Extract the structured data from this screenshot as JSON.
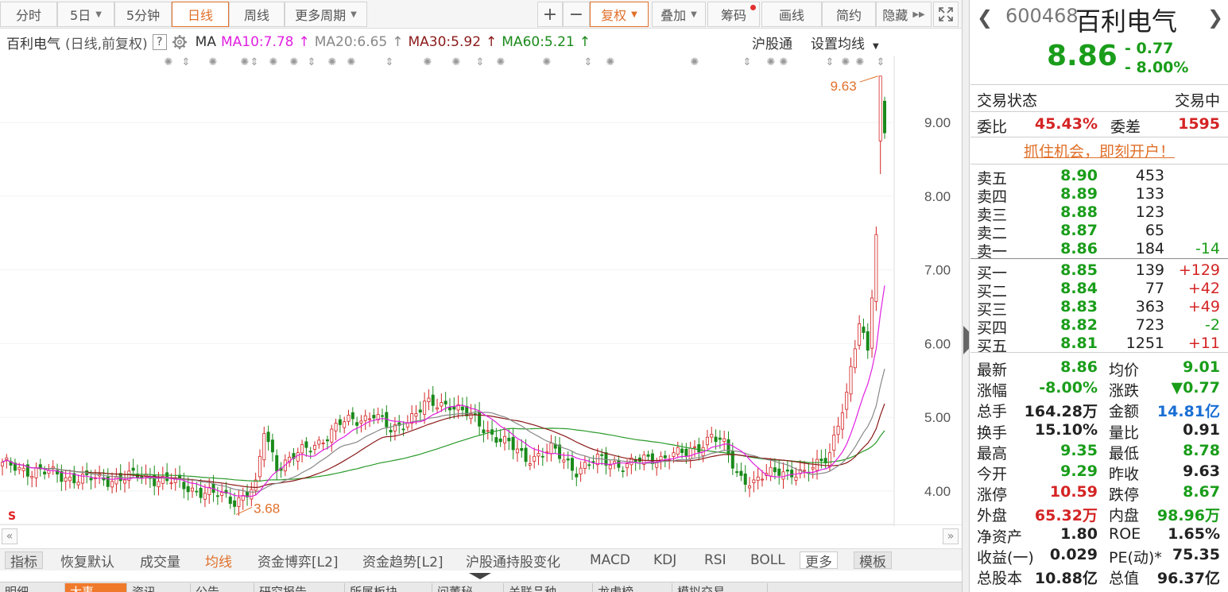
{
  "toolbar": {
    "tabs": [
      "分时",
      "5日",
      "5分钟",
      "日线",
      "周线",
      "更多周期"
    ],
    "active_tab": "日线",
    "plus": "+",
    "minus": "−",
    "fuquan": "复权",
    "diejia": "叠加",
    "chouma": "筹码",
    "huaxian": "画线",
    "jianyue": "简约",
    "yincang": "隐藏"
  },
  "info": {
    "name": "百利电气",
    "mode": "(日线,前复权)",
    "help": "?",
    "ma": "MA",
    "ma10": "MA10:7.78",
    "ma20": "MA20:6.65",
    "ma30": "MA30:5.92",
    "ma60": "MA60:5.21",
    "hgt": "沪股通",
    "set_ma": "设置均线"
  },
  "chart_data": {
    "type": "candlestick",
    "y_ticks": [
      "9.00",
      "8.00",
      "7.00",
      "6.00",
      "5.00",
      "4.00"
    ],
    "ylim": [
      3.6,
      9.8
    ],
    "high_label": "9.63",
    "low_label": "3.68",
    "ma_colors": {
      "ma10": "#e020e0",
      "ma20": "#888888",
      "ma30": "#8b1a1a",
      "ma60": "#2a9a2a"
    },
    "up_color": "#d42424",
    "down_color": "#1a8a1a"
  },
  "indicators": [
    "指标",
    "恢复默认",
    "成交量",
    "均线",
    "资金博弈[L2]",
    "资金趋势[L2]",
    "沪股通持股变化",
    "MACD",
    "KDJ",
    "RSI",
    "BOLL",
    "更多",
    "模板"
  ],
  "active_indicator": "均线",
  "bottom_tabs": [
    "明细",
    "大事",
    "资讯",
    "公告",
    "研究报告",
    "所属板块",
    "问董秘",
    "关联品种",
    "龙虎榜",
    "模拟交易"
  ],
  "active_bottom": "大事",
  "quote": {
    "code": "600468",
    "name": "百利电气",
    "price": "8.86",
    "change": "- 0.77",
    "change_pct": "- 8.00%",
    "status_label": "交易状态",
    "status_value": "交易中",
    "weibi_label": "委比",
    "weibi": "45.43%",
    "weicha_label": "委差",
    "weicha": "1595",
    "promo": "抓住机会，即刻开户！",
    "asks": [
      {
        "label": "卖五",
        "price": "8.90",
        "vol": "453",
        "delta": ""
      },
      {
        "label": "卖四",
        "price": "8.89",
        "vol": "133",
        "delta": ""
      },
      {
        "label": "卖三",
        "price": "8.88",
        "vol": "123",
        "delta": ""
      },
      {
        "label": "卖二",
        "price": "8.87",
        "vol": "65",
        "delta": ""
      },
      {
        "label": "卖一",
        "price": "8.86",
        "vol": "184",
        "delta": "-14"
      }
    ],
    "bids": [
      {
        "label": "买一",
        "price": "8.85",
        "vol": "139",
        "delta": "+129"
      },
      {
        "label": "买二",
        "price": "8.84",
        "vol": "77",
        "delta": "+42"
      },
      {
        "label": "买三",
        "price": "8.83",
        "vol": "363",
        "delta": "+49"
      },
      {
        "label": "买四",
        "price": "8.82",
        "vol": "723",
        "delta": "-2"
      },
      {
        "label": "买五",
        "price": "8.81",
        "vol": "1251",
        "delta": "+11"
      }
    ],
    "stats": [
      [
        "最新",
        "8.86",
        "均价",
        "9.01"
      ],
      [
        "涨幅",
        "-8.00%",
        "涨跌",
        "▼0.77"
      ],
      [
        "总手",
        "164.28万",
        "金额",
        "14.81亿"
      ],
      [
        "换手",
        "15.10%",
        "量比",
        "0.91"
      ],
      [
        "最高",
        "9.35",
        "最低",
        "8.78"
      ],
      [
        "今开",
        "9.29",
        "昨收",
        "9.63"
      ],
      [
        "涨停",
        "10.59",
        "跌停",
        "8.67"
      ],
      [
        "外盘",
        "65.32万",
        "内盘",
        "98.96万"
      ],
      [
        "净资产",
        "1.80",
        "ROE",
        "1.65%"
      ],
      [
        "收益(一)",
        "0.029",
        "PE(动)*",
        "75.35"
      ],
      [
        "总股本",
        "10.88亿",
        "总值",
        "96.37亿"
      ]
    ]
  }
}
